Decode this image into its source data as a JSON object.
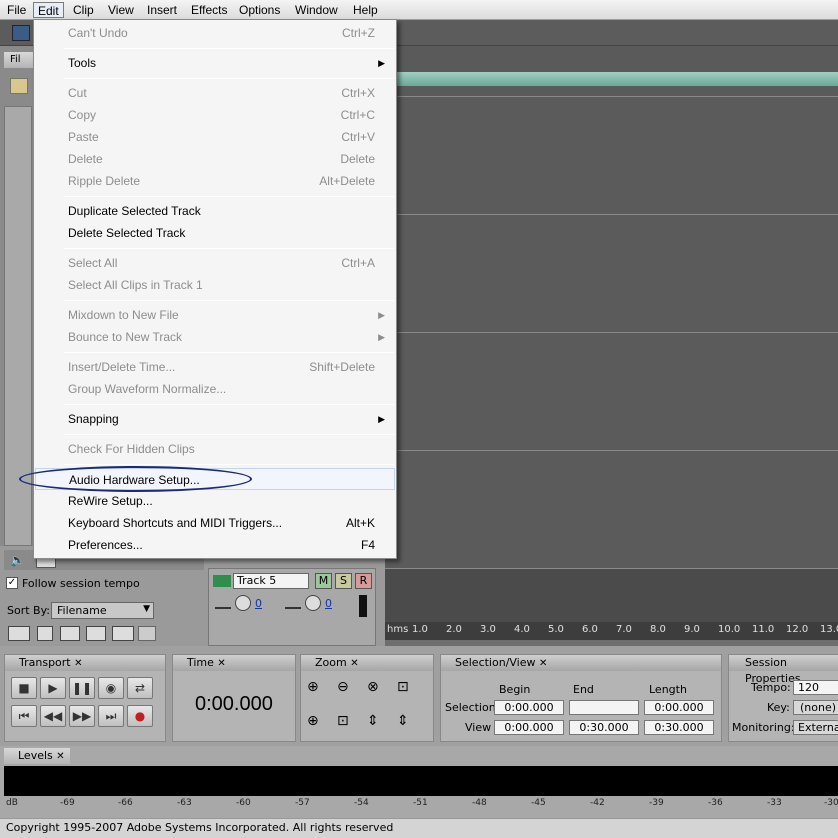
{
  "menubar": {
    "items": [
      "File",
      "Edit",
      "Clip",
      "View",
      "Insert",
      "Effects",
      "Options",
      "Window",
      "Help"
    ]
  },
  "files_panel": {
    "tab_label": "Fil"
  },
  "edit_menu": {
    "items": [
      {
        "label": "Can't Undo",
        "shortcut": "Ctrl+Z",
        "disabled": true
      },
      {
        "label": "Tools",
        "shortcut": "",
        "submenu": true,
        "disabled": false
      },
      {
        "label": "Cut",
        "shortcut": "Ctrl+X",
        "disabled": true
      },
      {
        "label": "Copy",
        "shortcut": "Ctrl+C",
        "disabled": true
      },
      {
        "label": "Paste",
        "shortcut": "Ctrl+V",
        "disabled": true
      },
      {
        "label": "Delete",
        "shortcut": "Delete",
        "disabled": true
      },
      {
        "label": "Ripple Delete",
        "shortcut": "Alt+Delete",
        "disabled": true
      },
      {
        "label": "Duplicate Selected Track",
        "shortcut": "",
        "disabled": false
      },
      {
        "label": "Delete Selected Track",
        "shortcut": "",
        "disabled": false
      },
      {
        "label": "Select All",
        "shortcut": "Ctrl+A",
        "disabled": true
      },
      {
        "label": "Select All Clips in Track 1",
        "shortcut": "",
        "disabled": true
      },
      {
        "label": "Mixdown to New File",
        "shortcut": "",
        "submenu": true,
        "disabled": true
      },
      {
        "label": "Bounce to New Track",
        "shortcut": "",
        "submenu": true,
        "disabled": true
      },
      {
        "label": "Insert/Delete Time...",
        "shortcut": "Shift+Delete",
        "disabled": true
      },
      {
        "label": "Group Waveform Normalize...",
        "shortcut": "",
        "disabled": true
      },
      {
        "label": "Snapping",
        "shortcut": "",
        "submenu": true,
        "disabled": false
      },
      {
        "label": "Check For Hidden Clips",
        "shortcut": "",
        "disabled": true
      },
      {
        "label": "Audio Hardware Setup...",
        "shortcut": "",
        "disabled": false,
        "highlighted": true
      },
      {
        "label": "ReWire Setup...",
        "shortcut": "",
        "disabled": false
      },
      {
        "label": "Keyboard Shortcuts and MIDI Triggers...",
        "shortcut": "Alt+K",
        "disabled": false
      },
      {
        "label": "Preferences...",
        "shortcut": "F4",
        "disabled": false
      }
    ]
  },
  "track_panel": {
    "follow_tempo_label": "Follow session tempo",
    "sort_by_label": "Sort By:",
    "sort_by_value": "Filename",
    "track_name": "Track 5",
    "mute": "M",
    "solo": "S",
    "record": "R",
    "vol_value": "0",
    "pan_value": "0"
  },
  "ruler": {
    "unit": "hms",
    "ticks": [
      "1.0",
      "2.0",
      "3.0",
      "4.0",
      "5.0",
      "6.0",
      "7.0",
      "8.0",
      "9.0",
      "10.0",
      "11.0",
      "12.0",
      "13.0"
    ]
  },
  "transport": {
    "title": "Transport"
  },
  "time": {
    "title": "Time",
    "value": "0:00.000"
  },
  "zoom": {
    "title": "Zoom"
  },
  "selection_view": {
    "title": "Selection/View",
    "col_begin": "Begin",
    "col_end": "End",
    "col_length": "Length",
    "row_selection": "Selection",
    "row_view": "View",
    "sel_begin": "0:00.000",
    "sel_end": "",
    "sel_length": "0:00.000",
    "view_begin": "0:00.000",
    "view_end": "0:30.000",
    "view_length": "0:30.000"
  },
  "session": {
    "title": "Session Properties",
    "tempo_label": "Tempo:",
    "tempo_value": "120",
    "key_label": "Key:",
    "key_value": "(none)",
    "monitoring_label": "Monitoring:",
    "monitoring_value": "External"
  },
  "levels": {
    "title": "Levels",
    "scale": [
      "dB",
      "-69",
      "-66",
      "-63",
      "-60",
      "-57",
      "-54",
      "-51",
      "-48",
      "-45",
      "-42",
      "-39",
      "-36",
      "-33",
      "-30"
    ]
  },
  "status": {
    "copyright": "Copyright 1995-2007 Adobe Systems Incorporated. All rights reserved"
  },
  "colors": {
    "accent": "#1a2a78",
    "track_green": "#6aa898",
    "record_red": "#c02020"
  }
}
